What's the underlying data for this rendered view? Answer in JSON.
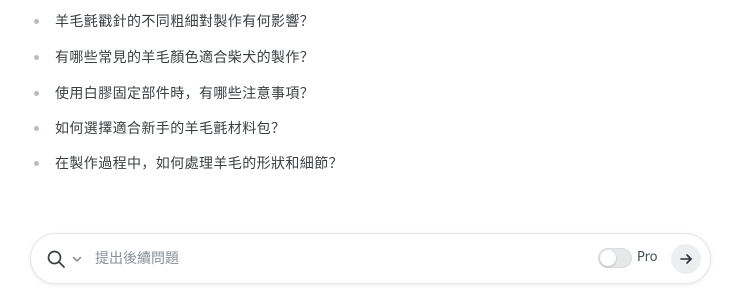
{
  "related": {
    "items": [
      {
        "label": "羊毛氈戳針的不同粗細對製作有何影響？"
      },
      {
        "label": "有哪些常見的羊毛顏色適合柴犬的製作？"
      },
      {
        "label": "使用白膠固定部件時，有哪些注意事項？"
      },
      {
        "label": "如何選擇適合新手的羊毛氈材料包？"
      },
      {
        "label": "在製作過程中，如何處理羊毛的形狀和細節？"
      }
    ]
  },
  "composer": {
    "placeholder": "提出後續問題",
    "focus_icon": "search-icon",
    "dropdown_icon": "chevron-down-icon",
    "toggle_label": "Pro",
    "toggle_on": false,
    "submit_icon": "arrow-right-icon"
  }
}
